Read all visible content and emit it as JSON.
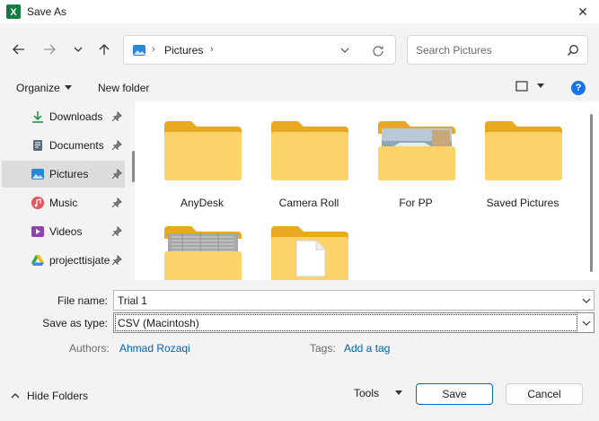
{
  "window": {
    "title": "Save As",
    "app_icon": "excel-icon"
  },
  "nav": {
    "address_segment": "Pictures",
    "search_placeholder": "Search Pictures"
  },
  "toolbar": {
    "organize_label": "Organize",
    "new_folder_label": "New folder"
  },
  "sidebar": {
    "items": [
      {
        "label": "Downloads",
        "icon": "download-icon",
        "pinned": true
      },
      {
        "label": "Documents",
        "icon": "documents-icon",
        "pinned": true
      },
      {
        "label": "Pictures",
        "icon": "pictures-icon",
        "pinned": true,
        "selected": true
      },
      {
        "label": "Music",
        "icon": "music-icon",
        "pinned": true
      },
      {
        "label": "Videos",
        "icon": "videos-icon",
        "pinned": true
      },
      {
        "label": "projecttisjate",
        "icon": "google-drive-icon",
        "pinned": true
      }
    ]
  },
  "folders": [
    {
      "name": "AnyDesk",
      "thumbnail": "none"
    },
    {
      "name": "Camera Roll",
      "thumbnail": "none"
    },
    {
      "name": "For PP",
      "thumbnail": "photo"
    },
    {
      "name": "Saved Pictures",
      "thumbnail": "none"
    },
    {
      "name": "",
      "thumbnail": "document-grid"
    },
    {
      "name": "",
      "thumbnail": "file"
    }
  ],
  "form": {
    "file_name_label": "File name:",
    "file_name_value": "Trial 1",
    "save_type_label": "Save as type:",
    "save_type_value": "CSV (Macintosh)",
    "authors_label": "Authors:",
    "authors_value": "Ahmad Rozaqi",
    "tags_label": "Tags:",
    "tags_value": "Add a tag"
  },
  "footer": {
    "hide_folders_label": "Hide Folders",
    "tools_label": "Tools",
    "save_label": "Save",
    "cancel_label": "Cancel"
  },
  "colors": {
    "folder": "#f7c948",
    "accent": "#0067c0",
    "link": "#0063b1"
  }
}
